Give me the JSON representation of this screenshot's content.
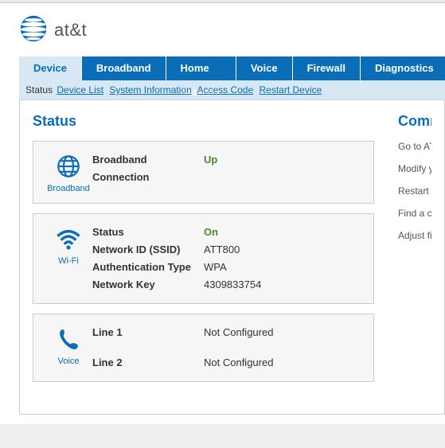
{
  "brand": "at&t",
  "tabs": [
    "Device",
    "Broadband",
    "Home Network",
    "Voice",
    "Firewall",
    "Diagnostics"
  ],
  "activeTab": 0,
  "subnav": {
    "static": "Status",
    "links": [
      "Device List",
      "System Information",
      "Access Code",
      "Restart Device"
    ]
  },
  "status": {
    "title": "Status",
    "broadband": {
      "iconLabel": "Broadband",
      "label": "Broadband Connection",
      "value": "Up"
    },
    "wifi": {
      "iconLabel": "Wi-Fi",
      "rows": [
        {
          "label": "Status",
          "value": "On",
          "cls": "green"
        },
        {
          "label": "Network ID (SSID)",
          "value": "ATT800",
          "cls": ""
        },
        {
          "label": "Authentication Type",
          "value": "WPA",
          "cls": ""
        },
        {
          "label": "Network Key",
          "value": "4309833754",
          "cls": ""
        }
      ]
    },
    "voice": {
      "iconLabel": "Voice",
      "rows": [
        {
          "label": "Line 1",
          "value": "Not Configured"
        },
        {
          "label": "Line 2",
          "value": "Not Configured"
        }
      ]
    }
  },
  "common": {
    "title": "Common",
    "items": [
      "Go to AT&T",
      "Modify you",
      "Restart yo",
      "Find a con",
      "Adjust fire"
    ]
  }
}
